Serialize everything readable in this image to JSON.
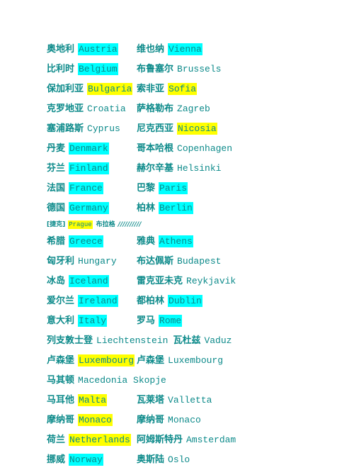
{
  "page": {
    "background_color": "#ffffff",
    "text_color": "#0c8a8a",
    "highlight_cyan": "#00ffff",
    "highlight_yellow": "#ffff00",
    "title": "Europe country and capital bilingual list"
  },
  "rows": [
    {
      "type": "pair",
      "country_zh": "奥地利",
      "country_en": "Austria",
      "country_highlight": "cyan",
      "capital_zh": "维也纳",
      "capital_en": "Vienna",
      "capital_highlight": "cyan"
    },
    {
      "type": "pair",
      "country_zh": "比利时",
      "country_en": "Belgium",
      "country_highlight": "cyan",
      "capital_zh": "布鲁塞尔",
      "capital_en": "Brussels",
      "capital_highlight": "none"
    },
    {
      "type": "pair",
      "country_zh": "保加利亚",
      "country_en": "Bulgaria",
      "country_highlight": "yellow",
      "capital_zh": "索非亚",
      "capital_en": "Sofia",
      "capital_highlight": "yellow"
    },
    {
      "type": "pair",
      "country_zh": "克罗地亚",
      "country_en": "Croatia",
      "country_highlight": "none",
      "capital_zh": "萨格勒布",
      "capital_en": "Zagreb",
      "capital_highlight": "none"
    },
    {
      "type": "pair",
      "country_zh": "塞浦路斯",
      "country_en": "Cyprus",
      "country_highlight": "none",
      "capital_zh": "尼克西亚",
      "capital_en": "Nicosia",
      "capital_highlight": "yellow"
    },
    {
      "type": "pair",
      "country_zh": "丹麦",
      "country_en": "Denmark",
      "country_highlight": "cyan",
      "capital_zh": "哥本哈根",
      "capital_en": "Copenhagen",
      "capital_highlight": "none"
    },
    {
      "type": "pair",
      "country_zh": "芬兰",
      "country_en": "Finland",
      "country_highlight": "cyan",
      "capital_zh": "赫尔辛基",
      "capital_en": "Helsinki",
      "capital_highlight": "none"
    },
    {
      "type": "pair",
      "country_zh": "法国",
      "country_en": "France",
      "country_highlight": "cyan",
      "capital_zh": "巴黎",
      "capital_en": "Paris",
      "capital_highlight": "cyan"
    },
    {
      "type": "pair",
      "country_zh": "德国",
      "country_en": "Germany",
      "country_highlight": "cyan",
      "capital_zh": "柏林",
      "capital_en": "Berlin",
      "capital_highlight": "cyan"
    },
    {
      "type": "note",
      "bracket": "[捷克]",
      "note_en": "Prague",
      "note_highlight": "yellow",
      "note_zh": "布拉格",
      "note_trail": "//////////"
    },
    {
      "type": "pair",
      "country_zh": "希腊",
      "country_en": "Greece",
      "country_highlight": "cyan",
      "capital_zh": "雅典",
      "capital_en": "Athens",
      "capital_highlight": "cyan"
    },
    {
      "type": "pair",
      "country_zh": "匈牙利",
      "country_en": "Hungary",
      "country_highlight": "none",
      "capital_zh": "布达佩斯",
      "capital_en": "Budapest",
      "capital_highlight": "none"
    },
    {
      "type": "pair",
      "country_zh": "冰岛",
      "country_en": "Iceland",
      "country_highlight": "cyan",
      "capital_zh": "雷克亚未克",
      "capital_en": "Reykjavik",
      "capital_highlight": "none"
    },
    {
      "type": "pair",
      "country_zh": "爱尔兰",
      "country_en": "Ireland",
      "country_highlight": "cyan",
      "capital_zh": "都柏林",
      "capital_en": "Dublin",
      "capital_highlight": "cyan"
    },
    {
      "type": "pair",
      "country_zh": "意大利",
      "country_en": "Italy",
      "country_highlight": "cyan",
      "capital_zh": "罗马",
      "capital_en": "Rome",
      "capital_highlight": "cyan"
    },
    {
      "type": "wide",
      "country_zh": "列支敦士登",
      "country_en": "Liechtenstein",
      "country_highlight": "none",
      "capital_zh": "瓦杜兹",
      "capital_en": "Vaduz",
      "capital_highlight": "none"
    },
    {
      "type": "pair",
      "country_zh": "卢森堡",
      "country_en": "Luxembourg",
      "country_highlight": "yellow",
      "capital_zh": "卢森堡",
      "capital_en": "Luxembourg",
      "capital_highlight": "none"
    },
    {
      "type": "single",
      "country_zh": "马其顿",
      "country_en": "Macedonia Skopje",
      "country_highlight": "none",
      "capital_zh": "",
      "capital_en": "",
      "capital_highlight": "none"
    },
    {
      "type": "pair",
      "country_zh": "马耳他",
      "country_en": "Malta",
      "country_highlight": "yellow",
      "capital_zh": "瓦莱塔",
      "capital_en": "Valletta",
      "capital_highlight": "none"
    },
    {
      "type": "pair",
      "country_zh": "摩纳哥",
      "country_en": "Monaco",
      "country_highlight": "yellow",
      "capital_zh": "摩纳哥",
      "capital_en": "Monaco",
      "capital_highlight": "none"
    },
    {
      "type": "pair",
      "country_zh": "荷兰",
      "country_en": "Netherlands",
      "country_highlight": "yellow",
      "capital_zh": "阿姆斯特丹",
      "capital_en": "Amsterdam",
      "capital_highlight": "none"
    },
    {
      "type": "pair",
      "country_zh": "挪威",
      "country_en": "Norway",
      "country_highlight": "cyan",
      "capital_zh": "奥斯陆",
      "capital_en": "Oslo",
      "capital_highlight": "none"
    }
  ]
}
